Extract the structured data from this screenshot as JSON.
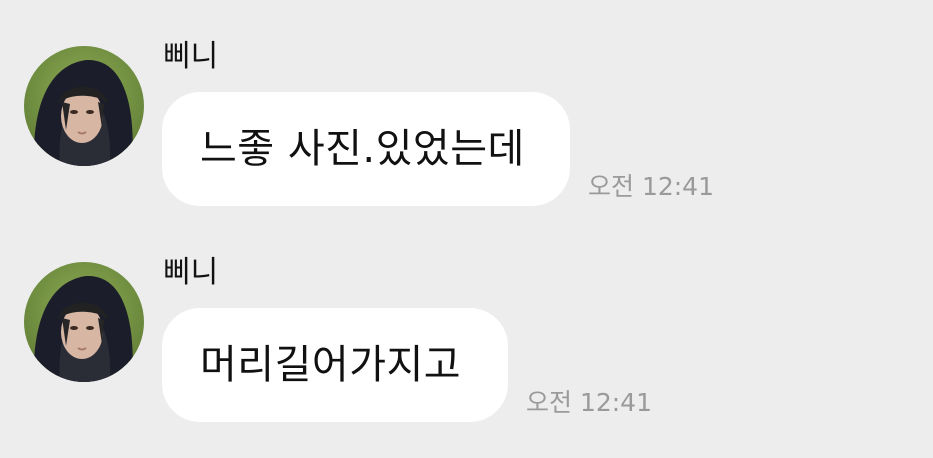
{
  "messages": [
    {
      "sender": "삐니",
      "text": "느좋 사진.있었는데",
      "time": "오전 12:41",
      "avatar_icon": "profile-photo-hooded-person"
    },
    {
      "sender": "삐니",
      "text": "머리길어가지고",
      "time": "오전 12:41",
      "avatar_icon": "profile-photo-hooded-person"
    }
  ],
  "colors": {
    "background": "#ededed",
    "bubble": "#ffffff",
    "text": "#111111",
    "timestamp": "#9a9a9a"
  }
}
